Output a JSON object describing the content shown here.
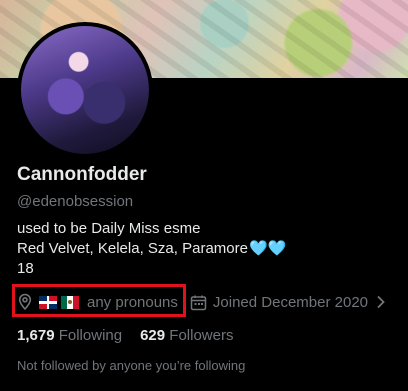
{
  "profile": {
    "display_name": "Cannonfodder",
    "handle": "@edenobsession",
    "bio_lines": [
      "used to be Daily Miss esme",
      "Red Velvet, Kelela, Sza, Paramore",
      "18"
    ],
    "bio_hearts": "🩵🩵",
    "pronouns": "any pronouns",
    "joined": "Joined December 2020",
    "following_count": "1,679",
    "following_label": "Following",
    "followers_count": "629",
    "followers_label": "Followers",
    "not_followed": "Not followed by anyone you’re following"
  },
  "icons": {
    "location": "location-pin-icon",
    "flag1": "dominican-republic-flag-icon",
    "flag2": "mexico-flag-icon",
    "calendar": "calendar-icon",
    "chevron": "chevron-right-icon"
  },
  "colors": {
    "background": "#000000",
    "primary_text": "#e7e9ea",
    "secondary_text": "#71767b",
    "highlight_box": "#e0121b"
  }
}
